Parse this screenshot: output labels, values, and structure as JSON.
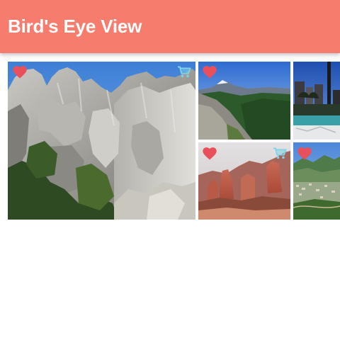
{
  "app_bar": {
    "title": "Bird's Eye View",
    "color": "#f67c6d"
  },
  "gallery": {
    "items": [
      {
        "scene": "granite-crags-pine-forest",
        "favorite": true,
        "cart": true
      },
      {
        "scene": "mountain-valley-snow-peak",
        "favorite": true,
        "cart": false
      },
      {
        "scene": "city-skyline-lake",
        "favorite": false,
        "cart": false
      },
      {
        "scene": "red-rock-canyon",
        "favorite": true,
        "cart": true
      },
      {
        "scene": "valley-town-green-hills",
        "favorite": true,
        "cart": false
      }
    ],
    "icons": {
      "favorite": "heart-icon",
      "cart": "cart-icon",
      "favorite_color": "#e8505b",
      "cart_color": "#7fd3e8"
    }
  }
}
